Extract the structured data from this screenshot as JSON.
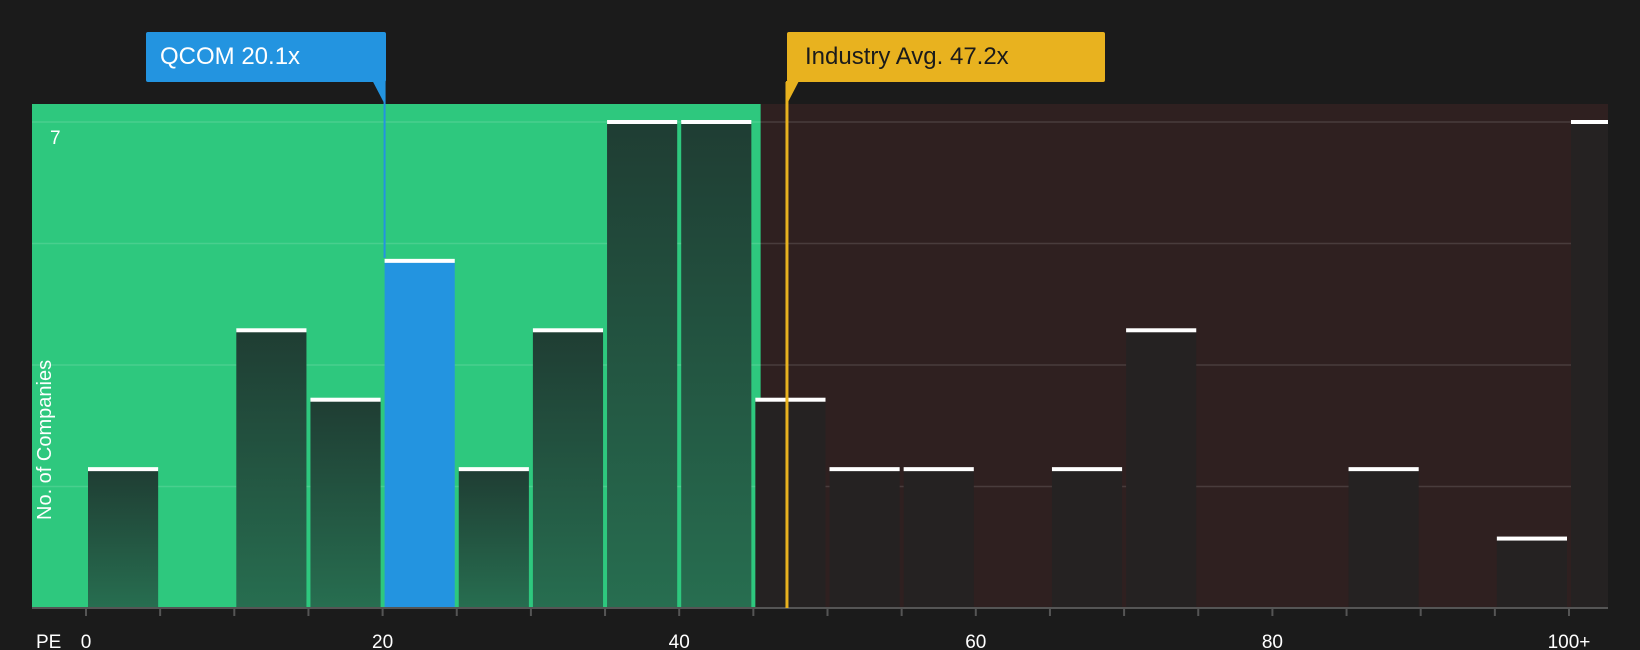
{
  "chart_data": {
    "type": "bar",
    "x_axis_name": "PE",
    "y_axis_title": "No. of Companies",
    "y_max_label": "7",
    "ylim": [
      0,
      7
    ],
    "x_ticks": [
      "0",
      "20",
      "40",
      "60",
      "80",
      "100+"
    ],
    "bin_width": 5,
    "bins": [
      {
        "start": 0,
        "count": 2
      },
      {
        "start": 5,
        "count": 0
      },
      {
        "start": 10,
        "count": 4
      },
      {
        "start": 15,
        "count": 3
      },
      {
        "start": 20,
        "count": 5,
        "highlight": true
      },
      {
        "start": 25,
        "count": 2
      },
      {
        "start": 30,
        "count": 4
      },
      {
        "start": 35,
        "count": 7
      },
      {
        "start": 40,
        "count": 7
      },
      {
        "start": 45,
        "count": 3
      },
      {
        "start": 50,
        "count": 2
      },
      {
        "start": 55,
        "count": 2
      },
      {
        "start": 60,
        "count": 0
      },
      {
        "start": 65,
        "count": 2
      },
      {
        "start": 70,
        "count": 4
      },
      {
        "start": 75,
        "count": 0
      },
      {
        "start": 80,
        "count": 0
      },
      {
        "start": 85,
        "count": 2
      },
      {
        "start": 90,
        "count": 0
      },
      {
        "start": 95,
        "count": 1
      },
      {
        "start": 100,
        "count": 7
      }
    ],
    "markers": {
      "company": {
        "label": "QCOM 20.1x",
        "value": 20.1,
        "color": "#2394e0"
      },
      "industry": {
        "label": "Industry Avg. 47.2x",
        "value": 47.2,
        "color": "#e8b21f"
      }
    },
    "colors": {
      "background": "#1b1b1b",
      "below_region": "#2ec87e",
      "above_region": "#2f2020",
      "bar_dark": "#23433a",
      "bar_neutral": "#252222",
      "highlight_bar": "#2394e0"
    }
  }
}
